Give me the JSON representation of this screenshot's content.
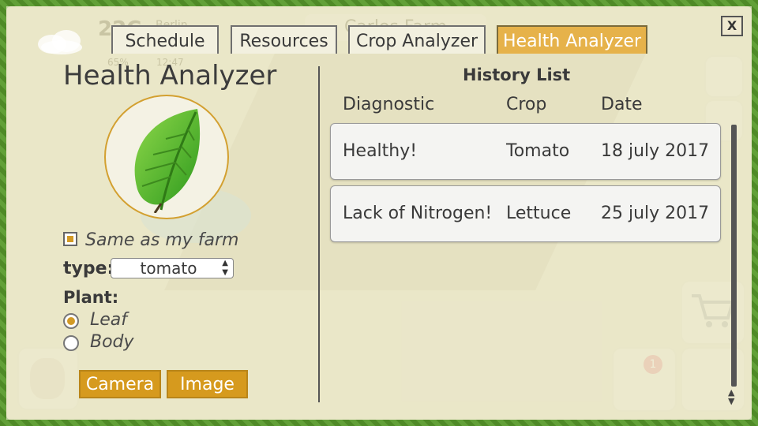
{
  "hud": {
    "temperature": "22C",
    "city": "Berlin",
    "humidity": "65%",
    "time": "12:47",
    "farm_name": "Carlos Farm",
    "notification_count_1": "1",
    "notification_count_2": "1"
  },
  "tabs": [
    {
      "label": "Schedule",
      "active": false
    },
    {
      "label": "Resources",
      "active": false
    },
    {
      "label": "Crop Analyzer",
      "active": false
    },
    {
      "label": "Health Analyzer",
      "active": true
    }
  ],
  "close_label": "X",
  "left": {
    "title": "Health Analyzer",
    "same_as_farm": "Same as my farm",
    "type_label": "type:",
    "type_value": "tomato",
    "plant_label": "Plant:",
    "plant_options": [
      "Leaf",
      "Body"
    ],
    "plant_selected": "Leaf",
    "camera_button": "Camera",
    "image_button": "Image"
  },
  "history": {
    "title": "History List",
    "columns": [
      "Diagnostic",
      "Crop",
      "Date"
    ],
    "rows": [
      {
        "diagnostic": "Healthy!",
        "crop": "Tomato",
        "date": "18 july 2017"
      },
      {
        "diagnostic": "Lack of Nitrogen!",
        "crop": "Lettuce",
        "date": "25 july 2017"
      }
    ]
  },
  "colors": {
    "accent": "#d69a1e",
    "active_tab": "#e6b24a",
    "border_green": "#4f8a27"
  }
}
